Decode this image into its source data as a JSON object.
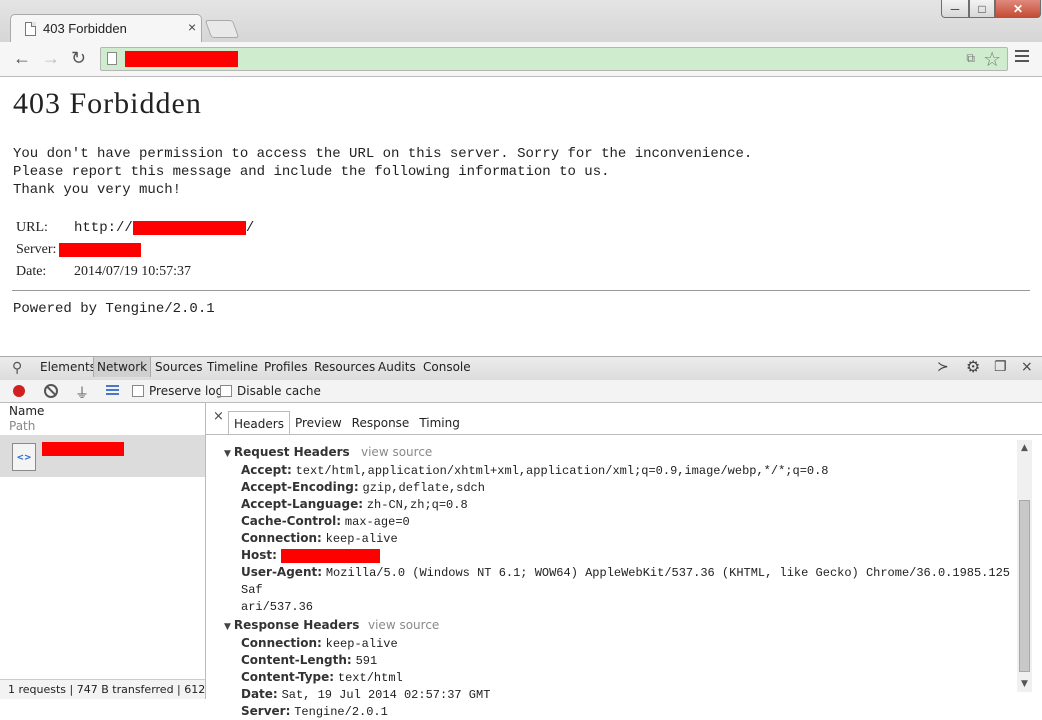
{
  "browser": {
    "tab_title": "403 Forbidden",
    "tab_close": "×",
    "window_buttons": {
      "minimize": "─",
      "maximize": "□",
      "close": "✕"
    }
  },
  "page": {
    "heading": "403 Forbidden",
    "message_lines": [
      "You don't have permission to access the URL on this server. Sorry for the inconvenience.",
      "Please report this message and include the following information to us.",
      "Thank you very much!"
    ],
    "info": {
      "url_label": "URL:",
      "url_prefix": "http://",
      "url_suffix": "/",
      "server_label": "Server:",
      "date_label": "Date:",
      "date_value": "2014/07/19 10:57:37"
    },
    "powered_by": "Powered by Tengine/2.0.1"
  },
  "devtools": {
    "tabs": [
      "Elements",
      "Network",
      "Sources",
      "Timeline",
      "Profiles",
      "Resources",
      "Audits",
      "Console"
    ],
    "active_tab": "Network",
    "preserve_log": "Preserve log",
    "disable_cache": "Disable cache",
    "list": {
      "col_name": "Name",
      "col_path": "Path",
      "summary": "1 requests | 747 B transferred | 612 ..."
    },
    "details": {
      "close": "×",
      "tabs": [
        "Headers",
        "Preview",
        "Response",
        "Timing"
      ],
      "active_tab": "Headers",
      "request_headers_title": "Request Headers",
      "response_headers_title": "Response Headers",
      "view_source": "view source",
      "request_headers": [
        {
          "key": "Accept:",
          "value": "text/html,application/xhtml+xml,application/xml;q=0.9,image/webp,*/*;q=0.8"
        },
        {
          "key": "Accept-Encoding:",
          "value": "gzip,deflate,sdch"
        },
        {
          "key": "Accept-Language:",
          "value": "zh-CN,zh;q=0.8"
        },
        {
          "key": "Cache-Control:",
          "value": "max-age=0"
        },
        {
          "key": "Connection:",
          "value": "keep-alive"
        },
        {
          "key": "Host:",
          "value": ""
        },
        {
          "key": "User-Agent:",
          "value": "Mozilla/5.0 (Windows NT 6.1; WOW64) AppleWebKit/537.36 (KHTML, like Gecko) Chrome/36.0.1985.125 Saf"
        },
        {
          "key": "",
          "value": "ari/537.36"
        }
      ],
      "response_headers": [
        {
          "key": "Connection:",
          "value": "keep-alive"
        },
        {
          "key": "Content-Length:",
          "value": "591"
        },
        {
          "key": "Content-Type:",
          "value": "text/html"
        },
        {
          "key": "Date:",
          "value": "Sat, 19 Jul 2014 02:57:37 GMT"
        },
        {
          "key": "Server:",
          "value": "Tengine/2.0.1"
        }
      ]
    }
  },
  "colors": {
    "redaction": "#ff0000",
    "omnibox_bg": "#cfeccf",
    "record_red": "#d21f1f"
  }
}
